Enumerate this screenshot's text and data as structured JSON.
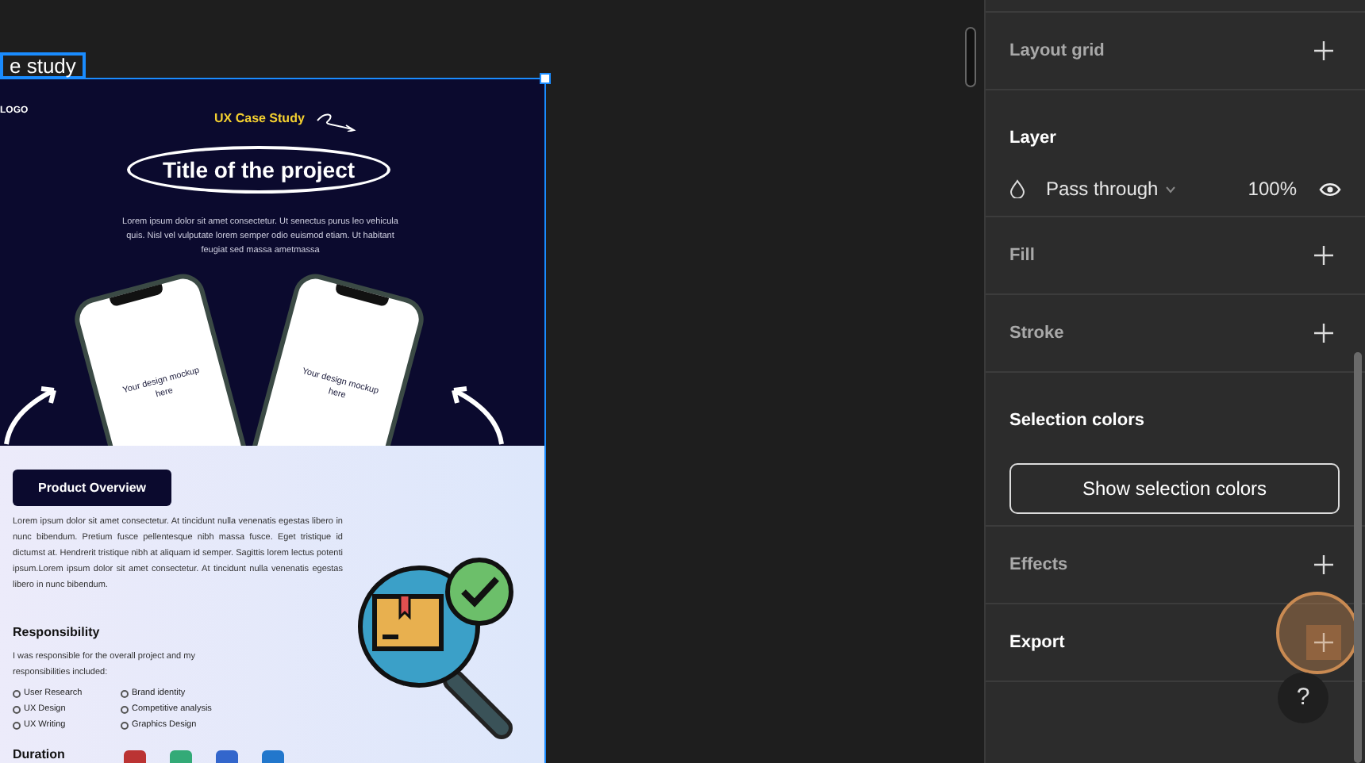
{
  "canvas": {
    "frame_label": "e study",
    "design": {
      "logo": "LOGO",
      "eyebrow": "UX Case Study",
      "title": "Title of the project",
      "intro": "Lorem ipsum dolor sit amet consectetur. Ut senectus purus leo vehicula quis. Nisl vel vulputate lorem semper odio euismod etiam. Ut habitant feugiat sed massa ametmassa",
      "phones": [
        "Your design mockup here",
        "Your design mockup here"
      ],
      "overview_button": "Product Overview",
      "overview_text": "Lorem ipsum dolor sit amet consectetur. At tincidunt nulla venenatis egestas libero in nunc bibendum. Pretium fusce pellentesque nibh massa fusce. Eget tristique id dictumst at. Hendrerit tristique nibh at aliquam id semper. Sagittis lorem lectus potenti ipsum.Lorem ipsum dolor sit amet consectetur. At tincidunt nulla venenatis egestas libero in nunc bibendum.",
      "responsibility_heading": "Responsibility",
      "responsibility_text": "I was responsible for the overall project and my responsibilities included:",
      "responsibilities": [
        "User Research",
        "Brand identity",
        "UX Design",
        "Competitive analysis",
        "UX Writing",
        "Graphics Design"
      ],
      "duration_heading": "Duration"
    }
  },
  "panel": {
    "sections": [
      {
        "kind": "add",
        "title": "Layout grid",
        "active": false
      },
      {
        "kind": "layer",
        "title": "Layer",
        "active": true,
        "blend_mode": "Pass through",
        "opacity": "100%"
      },
      {
        "kind": "add",
        "title": "Fill",
        "active": false
      },
      {
        "kind": "add",
        "title": "Stroke",
        "active": false
      },
      {
        "kind": "button",
        "title": "Selection colors",
        "active": true,
        "button": "Show selection colors"
      },
      {
        "kind": "add",
        "title": "Effects",
        "active": false
      },
      {
        "kind": "add",
        "title": "Export",
        "active": true,
        "highlighted": true
      }
    ],
    "help_button": "?"
  }
}
